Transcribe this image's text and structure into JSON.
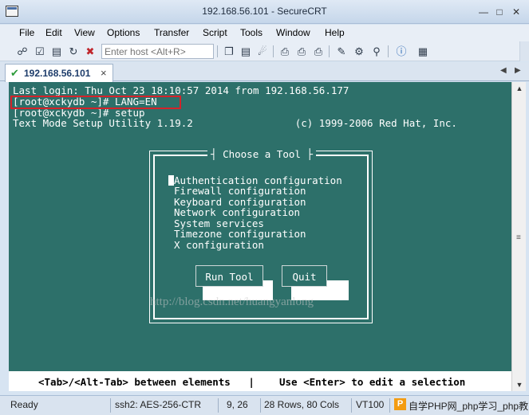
{
  "window": {
    "title": "192.168.56.101 - SecureCRT"
  },
  "menu": [
    "File",
    "Edit",
    "View",
    "Options",
    "Transfer",
    "Script",
    "Tools",
    "Window",
    "Help"
  ],
  "toolbar": {
    "host_placeholder": "Enter host <Alt+R>"
  },
  "tab": {
    "label": "192.168.56.101"
  },
  "terminal": {
    "lines": [
      "Last login: Thu Oct 23 18:10:57 2014 from 192.168.56.177",
      "[root@xckydb ~]# LANG=EN",
      "[root@xckydb ~]# setup",
      "Text Mode Setup Utility 1.19.2                 (c) 1999-2006 Red Hat, Inc."
    ],
    "dialog": {
      "title": "Choose a Tool",
      "items": [
        "Authentication configuration",
        "Firewall configuration",
        "Keyboard configuration",
        "Network configuration",
        "System services",
        "Timezone configuration",
        "X configuration"
      ],
      "run_button": "Run Tool",
      "quit_button": "Quit"
    },
    "hint_left": "<Tab>/<Alt-Tab> between elements   |",
    "hint_right": "Use <Enter> to edit a selection",
    "watermark": "http://blog.csdn.net/huangyanlong"
  },
  "status": {
    "ready": "Ready",
    "cipher": "ssh2: AES-256-CTR",
    "position": "9,  26",
    "size": "28 Rows, 80 Cols",
    "emulation": "VT100",
    "badge": "P",
    "site": "自学PHP网_php学习_php教"
  },
  "colors": {
    "terminal_bg": "#2d706a",
    "highlight": "#d4232a"
  }
}
